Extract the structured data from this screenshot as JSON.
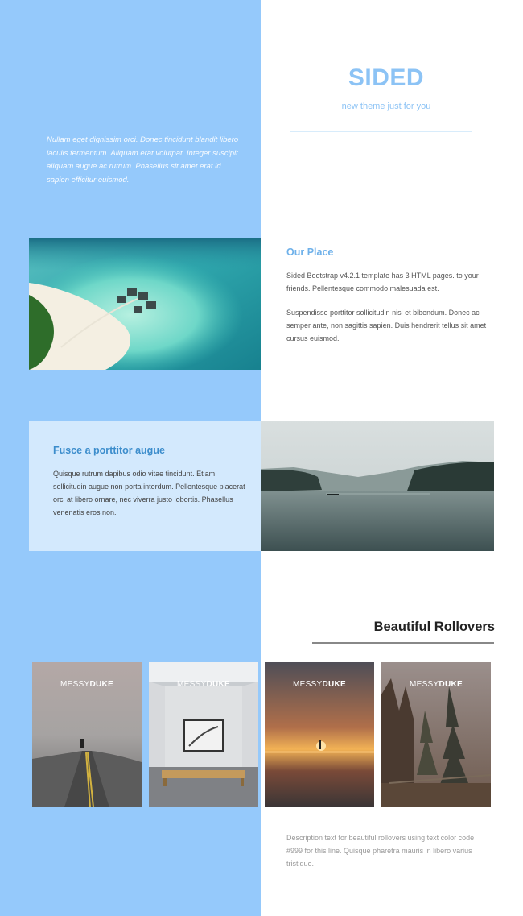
{
  "intro": {
    "text": "Nullam eget dignissim orci. Donec tincidunt blandit libero iaculis fermentum. Aliquam erat volutpat. Integer suscipit aliquam augue ac rutrum. Phasellus sit amet erat id sapien efficitur euismod."
  },
  "brand": {
    "title": "SIDED",
    "tagline": "new theme just for you"
  },
  "our_place": {
    "title": "Our Place",
    "p1": "Sided Bootstrap v4.2.1 template has 3 HTML pages. to your friends. Pellentesque commodo malesuada est.",
    "p2": "Suspendisse porttitor sollicitudin nisi et bibendum. Donec ac semper ante, non sagittis sapien. Duis hendrerit tellus sit amet cursus euismod."
  },
  "fusce": {
    "title": "Fusce a porttitor augue",
    "text": "Quisque rutrum dapibus odio vitae tincidunt. Etiam sollicitudin augue non porta interdum. Pellentesque placerat orci at libero ornare, nec viverra justo lobortis. Phasellus venenatis eros non."
  },
  "rollovers": {
    "title": "Beautiful Rollovers",
    "cards": [
      {
        "brand_light": "MESSY",
        "brand_bold": "DUKE"
      },
      {
        "brand_light": "MESSY",
        "brand_bold": "DUKE"
      },
      {
        "brand_light": "MESSY",
        "brand_bold": "DUKE"
      },
      {
        "brand_light": "MESSY",
        "brand_bold": "DUKE"
      }
    ],
    "description": "Description text for beautiful rollovers using text color code #999 for this line. Quisque pharetra mauris in libero varius tristique."
  },
  "colors": {
    "side_panel": "#95c9fb",
    "accent": "#8cc3f5",
    "box_tint": "#d3e9fd"
  }
}
